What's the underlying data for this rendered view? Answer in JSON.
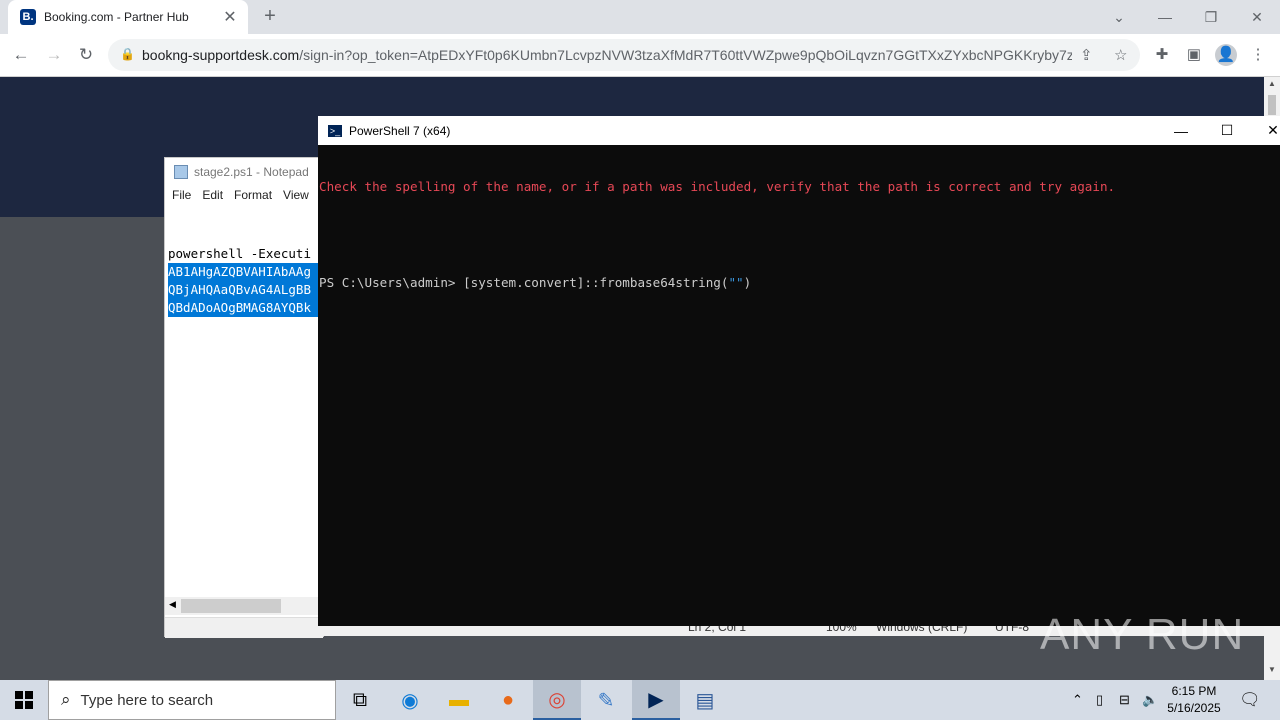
{
  "browser": {
    "tab_title": "Booking.com - Partner Hub",
    "favicon_letter": "B.",
    "url_domain": "bookng-supportdesk.com",
    "url_path": "/sign-in?op_token=AtpEDxYFt0p6KUmbn7LcvpzNVW3tzaXfMdR7T60ttVWZpwe9pQbOiLqvzn7GGtTXxZYxbcNPGKKryby7zF..."
  },
  "notepad": {
    "title": "stage2.ps1 - Notepad",
    "menu": [
      "File",
      "Edit",
      "Format",
      "View"
    ],
    "line1": "powershell -Executi",
    "line2": "AB1AHgAZQBVAHIAbAAg",
    "line3": "QBjAHQAaQBvAG4ALgBB",
    "line4": "QBdADoAOgBMAG8AYQBk",
    "status": {
      "position": "Ln 2, Col 1",
      "zoom": "100%",
      "eol": "Windows (CRLF)",
      "encoding": "UTF-8"
    }
  },
  "powershell": {
    "title": "PowerShell 7 (x64)",
    "error_line": "Check the spelling of the name, or if a path was included, verify that the path is correct and try again.",
    "prompt": "PS C:\\Users\\admin> ",
    "command": "[system.convert]::frombase64string(",
    "string_arg": "\"\"",
    "command_end": ")"
  },
  "watermark": "ANY RUN",
  "taskbar": {
    "search_placeholder": "Type here to search",
    "time": "6:15 PM",
    "date": "5/16/2025"
  },
  "colors": {
    "ps_error": "#e74856",
    "ps_background": "#0c0c0c",
    "selection": "#0078d7",
    "booking_blue": "#003580"
  }
}
